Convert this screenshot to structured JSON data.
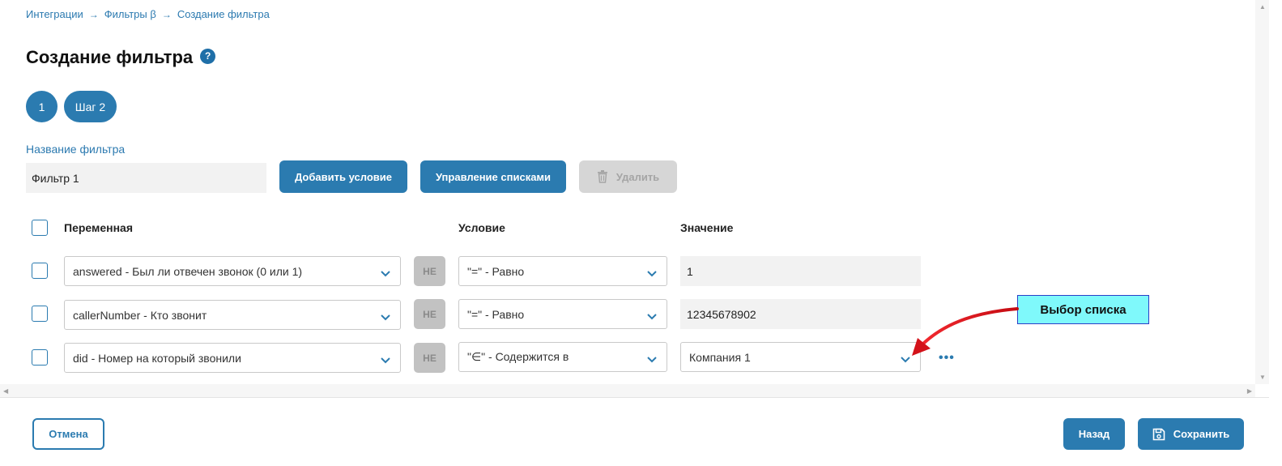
{
  "breadcrumb": {
    "items": [
      "Интеграции",
      "Фильтры β",
      "Создание фильтра"
    ],
    "separator": "→"
  },
  "page": {
    "title": "Создание фильтра",
    "help_icon": "?"
  },
  "steps": [
    "1",
    "Шаг 2"
  ],
  "filter": {
    "label": "Название фильтра",
    "value": "Фильтр 1"
  },
  "toolbar": {
    "add_condition": "Добавить условие",
    "manage_lists": "Управление списками",
    "delete": "Удалить"
  },
  "table": {
    "headers": {
      "variable": "Переменная",
      "condition": "Условие",
      "value": "Значение"
    },
    "not_label": "НЕ",
    "rows": [
      {
        "variable": "answered - Был ли отвечен звонок (0 или 1)",
        "condition": "\"=\" - Равно",
        "value": "1"
      },
      {
        "variable": "callerNumber - Кто звонит",
        "condition": "\"=\" - Равно",
        "value": "12345678902"
      },
      {
        "variable": "did - Номер на который звонили",
        "condition": "\"∈\" - Содержится в",
        "value": "Компания 1"
      }
    ],
    "more_label": "•••"
  },
  "annotation": {
    "callout": "Выбор списка"
  },
  "footer": {
    "cancel": "Отмена",
    "back": "Назад",
    "save": "Сохранить"
  },
  "colors": {
    "primary": "#2b7bb0",
    "link": "#2c7ab0",
    "disabled": "#d6d6d6",
    "callout_bg": "#7ff9fb",
    "arrow": "#e8111b"
  }
}
